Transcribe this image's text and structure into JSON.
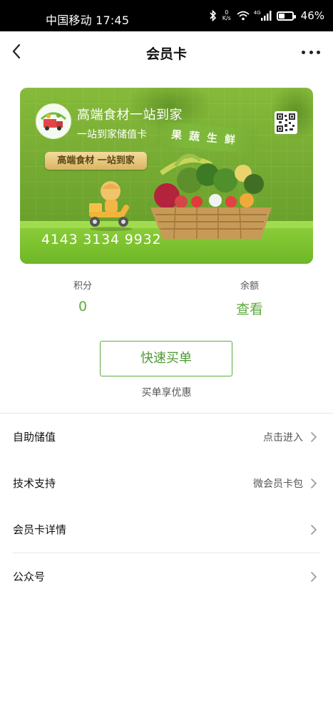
{
  "status_bar": {
    "carrier_time": "中国移动 17:45",
    "net_speed_value": "0",
    "net_speed_unit": "K/s",
    "network_type": "4G",
    "battery_percent": "46%",
    "battery_level": 0.46
  },
  "nav": {
    "title": "会员卡",
    "back_icon": "chevron-left-icon",
    "more_icon": "more-dots-icon"
  },
  "card": {
    "title": "高端食材一站到家",
    "subtitle": "一站到家储值卡",
    "ribbon_text": "果蔬生鲜",
    "tagline": "高端食材 一站到家",
    "number": "4143 3134 9932",
    "qr_icon": "qr-code-icon",
    "colors": {
      "green": "#74a932",
      "floor": "#8fd03c",
      "gold": "#d9b462"
    }
  },
  "stats": {
    "points_label": "积分",
    "points_value": "0",
    "balance_label": "余额",
    "balance_value": "查看"
  },
  "quick_buy": {
    "button_label": "快速买单",
    "note": "买单享优惠"
  },
  "menu": [
    {
      "label": "自助储值",
      "value": "点击进入"
    },
    {
      "label": "技术支持",
      "value": "微会员卡包"
    },
    {
      "label": "会员卡详情",
      "value": ""
    },
    {
      "label": "公众号",
      "value": ""
    }
  ],
  "accent_color": "#5daa3f"
}
